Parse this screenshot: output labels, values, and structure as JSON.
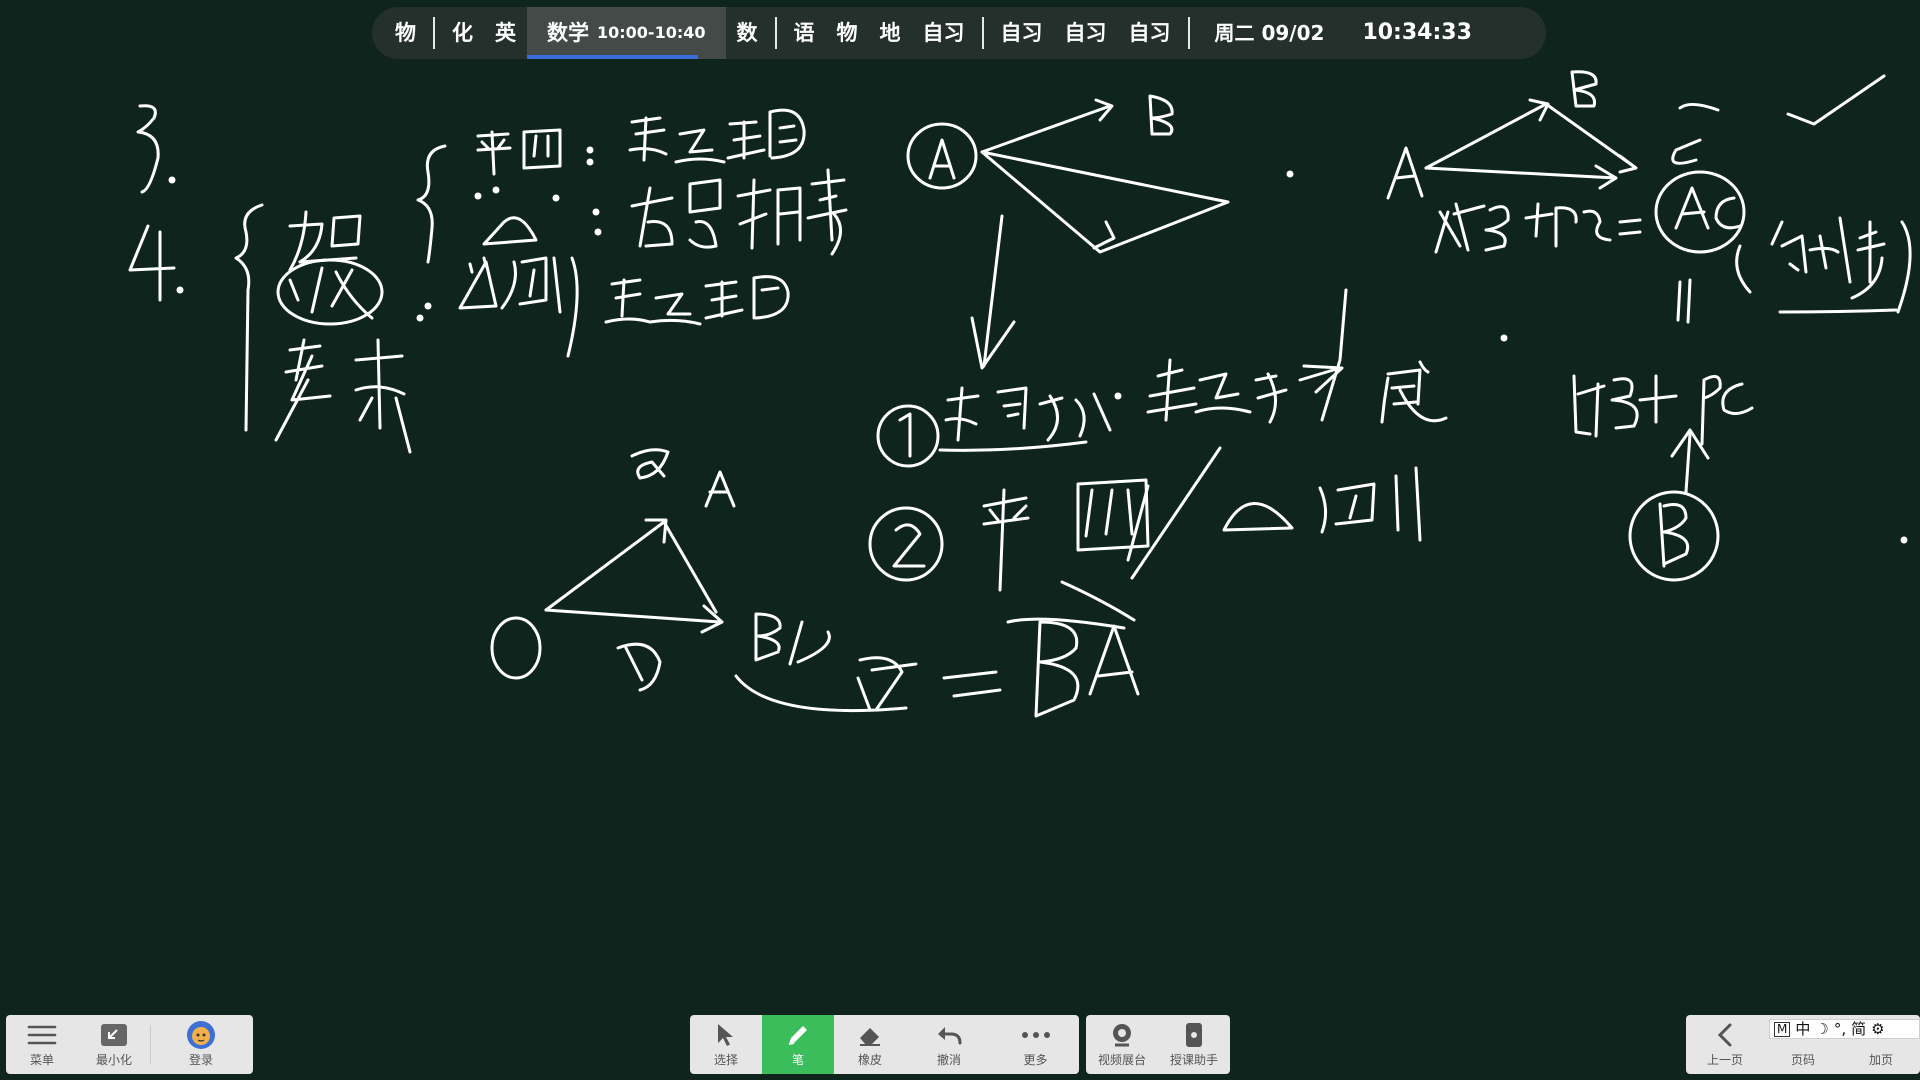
{
  "schedule": {
    "periods_before": [
      "物",
      "化",
      "英"
    ],
    "current": {
      "subject": "数学",
      "time": "10:00-10:40",
      "progress": 0.86
    },
    "periods_after_1": [
      "数"
    ],
    "periods_after_2": [
      "语",
      "物",
      "地",
      "自习"
    ],
    "periods_after_3": [
      "自习",
      "自习",
      "自习"
    ],
    "date": "周二 09/02",
    "clock": "10:34:33"
  },
  "left_toolbar": {
    "menu": "菜单",
    "minimize": "最小化",
    "login": "登录"
  },
  "center_toolbar": {
    "select": "选择",
    "pen": "笔",
    "eraser": "橡皮",
    "undo": "撤消",
    "more": "更多",
    "video": "视频展台",
    "assistant": "授课助手"
  },
  "right_toolbar": {
    "prev_page": "上一页",
    "page_code": "页码",
    "add_page": "加页"
  },
  "ime": {
    "mode": "M",
    "lang": "中",
    "moon": "☽",
    "punct": "°,",
    "script": "简",
    "settings": "⚙"
  },
  "board": {
    "ink_color": "#ffffff",
    "labels": {
      "n3": "3.",
      "n4": "4.",
      "a_vec": "a",
      "b_vec": "b",
      "circled1": "①",
      "circled2": "②",
      "A": "A",
      "B": "B",
      "C": "C",
      "O": "O",
      "BA": "BA",
      "formula": "AB + BC = AC",
      "check": "✓"
    }
  }
}
